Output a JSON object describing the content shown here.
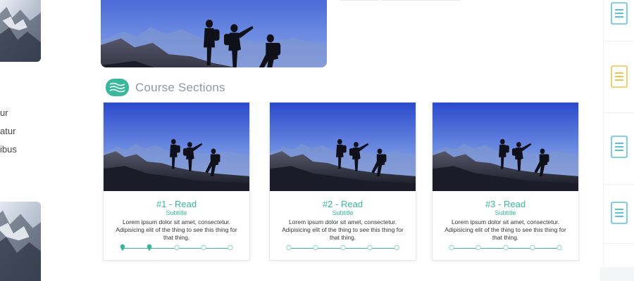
{
  "left_column": {
    "text_lines": [
      "ur",
      "atur",
      "ibus"
    ]
  },
  "hero": {
    "caption": "————  ————————"
  },
  "section": {
    "title": "Course Sections",
    "icon": "course-sections-icon"
  },
  "cards": [
    {
      "title": "#1 - Read",
      "subtitle": "Subtitle",
      "body": "Lorem ipsum dolor sit amet, consectetur. Adipisicing elit of the thing to see this thing for that thing.",
      "steps": [
        true,
        true,
        false,
        false,
        false
      ]
    },
    {
      "title": "#2 - Read",
      "subtitle": "Subtitle",
      "body": "Lorem ipsum dolor sit amet, consectetur. Adipisicing elit of the thing to see this thing for that thing.",
      "steps": [
        false,
        false,
        false,
        false,
        false
      ]
    },
    {
      "title": "#3 - Read",
      "subtitle": "Subtitle",
      "body": "Lorem ipsum dolor sit amet, consectetur. Adipisicing elit of the thing to see this thing for that thing.",
      "steps": [
        false,
        false,
        false,
        false,
        false
      ]
    }
  ],
  "rail": {
    "icons": [
      {
        "name": "document-icon",
        "color": "#5bc0de"
      },
      {
        "name": "document-icon",
        "color": "#f0c24b"
      },
      {
        "name": "document-icon",
        "color": "#5bc0de"
      },
      {
        "name": "document-icon",
        "color": "#5bc0de"
      }
    ]
  },
  "colors": {
    "accent": "#37b79a",
    "sky_top": "#2d4fd1",
    "sky_bottom": "#9bb6ee"
  }
}
